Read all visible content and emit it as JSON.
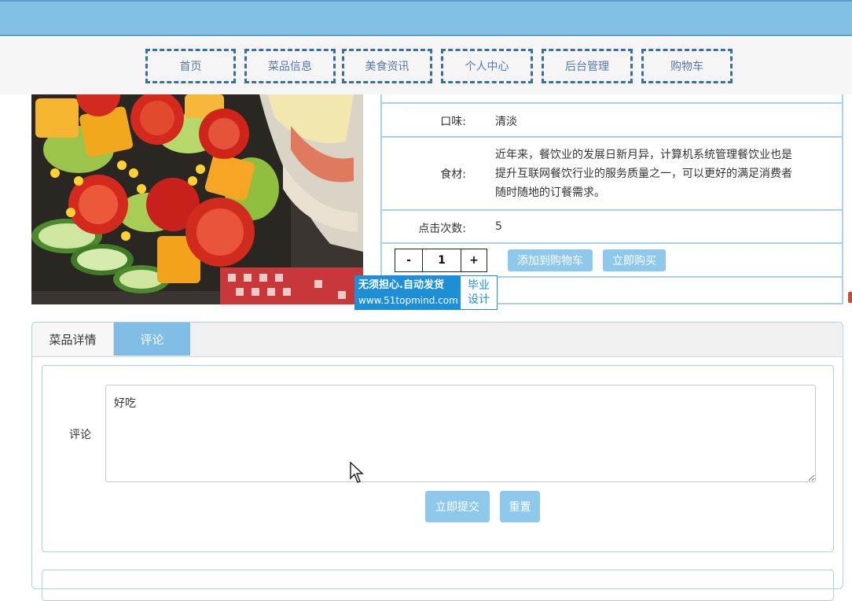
{
  "nav": {
    "items": [
      {
        "label": "首页"
      },
      {
        "label": "菜品信息"
      },
      {
        "label": "美食资讯"
      },
      {
        "label": "个人中心"
      },
      {
        "label": "后台管理"
      },
      {
        "label": "购物车"
      }
    ]
  },
  "product": {
    "taste_label": "口味:",
    "taste_value": "清淡",
    "ingredients_label": "食材:",
    "ingredients_lines": [
      "近年来，餐饮业的发展日新月异，计算机系统管理餐饮业也是",
      "提升互联网餐饮行业的服务质量之一，可以更好的满足消费者",
      "随时随地的订餐需求。"
    ],
    "clicks_label": "点击次数:",
    "clicks_value": "5",
    "quantity": {
      "minus": "-",
      "value": "1",
      "plus": "+"
    },
    "add_to_cart": "添加到购物车",
    "buy_now": "立即购买"
  },
  "watermark": {
    "line1": "无须担心.自动发货",
    "line2": "www.51topmind.com",
    "right1": "毕业",
    "right2": "设计"
  },
  "tabs": [
    {
      "label": "菜品详情",
      "active": false
    },
    {
      "label": "评论",
      "active": true
    }
  ],
  "comment_form": {
    "label": "评论",
    "value": "好吃",
    "submit": "立即提交",
    "reset": "重置"
  },
  "colors": {
    "topbar": "#82c0e6",
    "nav_border": "#3a6fa5",
    "accent_button": "#8ec8ea",
    "active_tab": "#7fbde4",
    "watermark": "#1c8fd6"
  }
}
